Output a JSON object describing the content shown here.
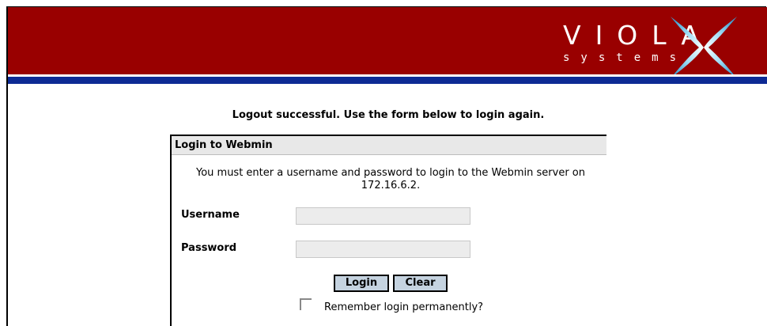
{
  "header": {
    "logo_word": "VIOLA",
    "logo_sub": "systems",
    "logo_icon": "viola-x-logo",
    "colors": {
      "banner": "#990000",
      "stripe": "#0d2a94",
      "logo_x": "#8fd3f0"
    }
  },
  "message": "Logout successful. Use the form below to login again.",
  "login": {
    "title": "Login to Webmin",
    "intro": "You must enter a username and password to login to the Webmin server on 172.16.6.2.",
    "username_label": "Username",
    "username_value": "",
    "password_label": "Password",
    "password_value": "",
    "login_button": "Login",
    "clear_button": "Clear",
    "remember_label": "Remember login permanently?",
    "remember_checked": false,
    "button_color": "#c5d3e0"
  }
}
